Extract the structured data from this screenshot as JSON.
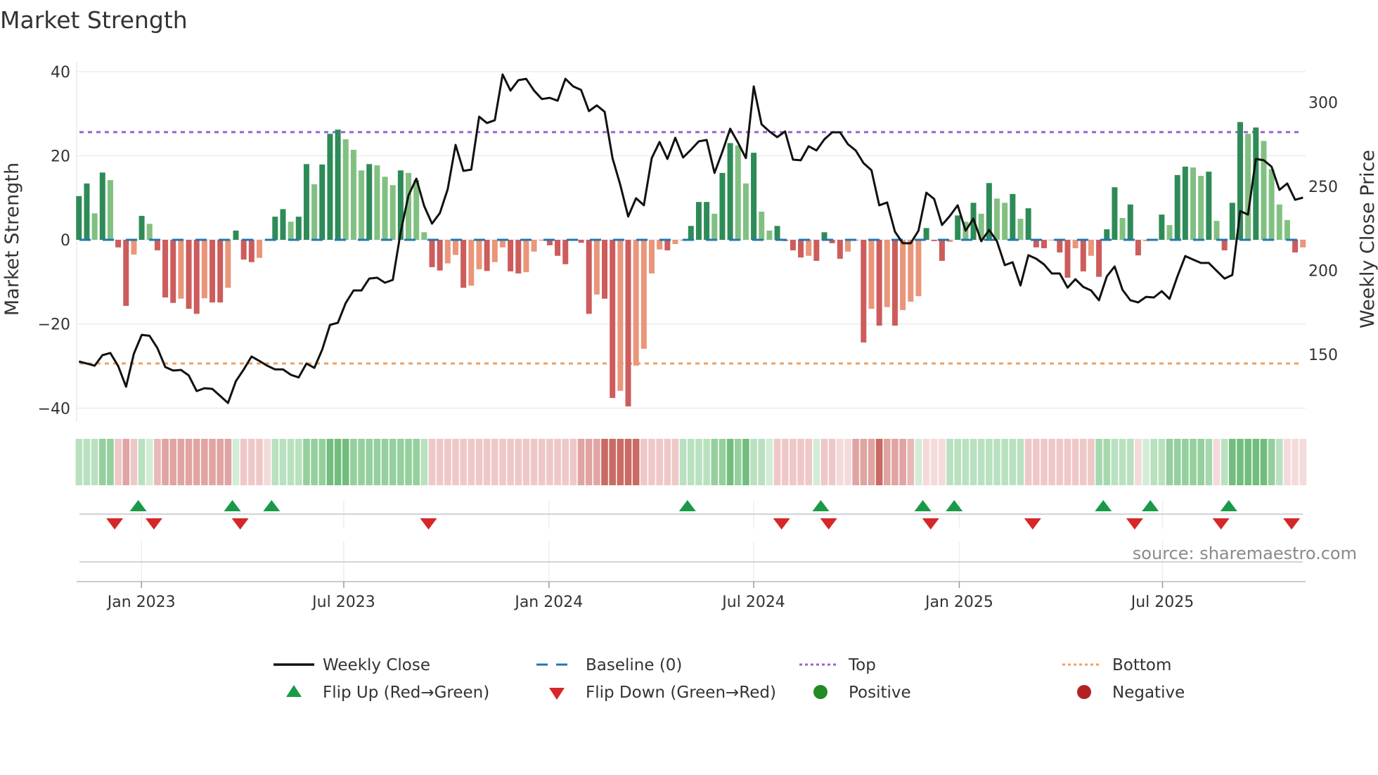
{
  "title": "Market Strength",
  "source": "source: sharemaestro.com",
  "colors": {
    "green_strong": "#2e8b57",
    "green_soft": "#82c082",
    "red_strong": "#cd5c5c",
    "red_soft": "#e9967a",
    "baseline": "#1f77b4",
    "top": "#9b5fd6",
    "bottom": "#f0a060",
    "price": "#111111",
    "flip_up": "#1a9a48",
    "flip_down": "#d62728",
    "positive": "#228b22",
    "negative": "#b22222"
  },
  "legend": [
    {
      "label": "Weekly Close",
      "kind": "line"
    },
    {
      "label": "Baseline (0)",
      "kind": "dash"
    },
    {
      "label": "Top",
      "kind": "dot-purple"
    },
    {
      "label": "Bottom",
      "kind": "dot-orange"
    },
    {
      "label": "Flip Up (Red→Green)",
      "kind": "triangle-up"
    },
    {
      "label": "Flip Down (Green→Red)",
      "kind": "triangle-down"
    },
    {
      "label": "Positive",
      "kind": "circle-green"
    },
    {
      "label": "Negative",
      "kind": "circle-red"
    }
  ],
  "chart_data": {
    "type": "bar",
    "title": "Market Strength",
    "ylabel": "Market Strength",
    "y2label": "Weekly Close Price",
    "ylim": [
      -43.3,
      42.3
    ],
    "y2lim": [
      109.7,
      324.1
    ],
    "yticks": [
      40,
      20,
      0,
      -20,
      -40
    ],
    "yticklabels": [
      "40",
      "20",
      "0",
      "−20",
      "−40"
    ],
    "y2ticks": [
      300,
      250,
      200,
      150
    ],
    "y2ticklabels": [
      "300",
      "250",
      "200",
      "150"
    ],
    "xticks": [
      {
        "label": "Jan 2023",
        "week": 7.97
      },
      {
        "label": "Jul 2023",
        "week": 33.75
      },
      {
        "label": "Jan 2024",
        "week": 59.9
      },
      {
        "label": "Jul 2024",
        "week": 86.0
      },
      {
        "label": "Jan 2025",
        "week": 112.2
      },
      {
        "label": "Jul 2025",
        "week": 138.1
      }
    ],
    "grid": true,
    "legend_position": "bottom",
    "top_level": 25.6,
    "bottom_level": -29.4,
    "baseline": 0,
    "strength": [
      10.4,
      13.4,
      6.3,
      16,
      14.2,
      -1.8,
      -15.7,
      -3.5,
      5.7,
      3.8,
      -2.5,
      -13.7,
      -15,
      -14,
      -16.4,
      -17.6,
      -13.9,
      -14.9,
      -14.9,
      -11.4,
      2.2,
      -4.7,
      -5.3,
      -4.3,
      -0.2,
      5.5,
      7.3,
      4.3,
      5.5,
      18,
      13.2,
      17.9,
      25.2,
      26.2,
      23.9,
      21.4,
      16.5,
      18,
      17.7,
      15,
      13,
      16.5,
      15.9,
      14.2,
      1.8,
      -6.5,
      -7.3,
      -5.6,
      -3.6,
      -11.4,
      -10.9,
      -7,
      -7.4,
      -5.3,
      -1.8,
      -7.5,
      -8,
      -7.7,
      -2.8,
      -0.2,
      -1.3,
      -3.8,
      -5.8,
      -0.1,
      -0.7,
      -17.6,
      -13,
      -14,
      -37.6,
      -35.9,
      -39.6,
      -29.9,
      -25.9,
      -8,
      -2.3,
      -2.5,
      -1,
      -0.2,
      3.3,
      9,
      9,
      6.2,
      15.9,
      23,
      22.4,
      13.4,
      20.7,
      6.7,
      2.2,
      3.3,
      -0.3,
      -2.5,
      -4.2,
      -3.8,
      -5,
      1.8,
      -0.8,
      -4.5,
      -2.8,
      -0.2,
      -24.4,
      -16.4,
      -20.4,
      -16,
      -20.4,
      -16.7,
      -14.7,
      -13.4,
      2.8,
      -0.3,
      -5,
      -0.5,
      5.8,
      4.3,
      8.8,
      6.2,
      13.5,
      9.8,
      8.8,
      10.9,
      5,
      7.5,
      -1.8,
      -2,
      -0.1,
      -3,
      -9,
      -2,
      -7.5,
      -3.8,
      -8.8,
      2.5,
      12.5,
      5.2,
      8.4,
      -3.7,
      -0.3,
      0.1,
      6,
      3.5,
      15.4,
      17.4,
      17.2,
      15.2,
      16.2,
      4.5,
      -2.5,
      8.8,
      28,
      25.2,
      26.7,
      23.5,
      16.8,
      8.4,
      4.7,
      -3,
      -1.8
    ],
    "weekly_close": [
      145.7,
      144.5,
      143.2,
      149.5,
      150.8,
      143,
      130.7,
      150.3,
      161.6,
      161,
      153.7,
      142.4,
      140.3,
      140.7,
      137.4,
      128.1,
      129.8,
      129.4,
      125.2,
      121,
      134,
      141,
      148.7,
      146,
      143.2,
      141,
      141,
      137.8,
      136.2,
      144.5,
      141.9,
      152.8,
      167.5,
      168.8,
      180.5,
      188,
      188,
      195.1,
      195.6,
      192.6,
      194.3,
      222.8,
      244.6,
      254.6,
      238.3,
      227.8,
      234.1,
      248.3,
      274.7,
      259.2,
      260,
      291.5,
      287.7,
      289.4,
      316.6,
      307,
      313.2,
      314,
      307,
      302,
      302.7,
      301,
      314,
      309.5,
      307.4,
      294.8,
      298.2,
      294.4,
      266.8,
      250.8,
      232,
      242.9,
      238.7,
      266.8,
      276.4,
      266.3,
      278.9,
      267.2,
      271.8,
      276.8,
      277.6,
      258,
      270.5,
      284.3,
      276,
      266.8,
      309.5,
      286.9,
      282.7,
      279.3,
      282.7,
      265.9,
      265.5,
      273.9,
      271.4,
      278,
      282.2,
      282.2,
      275.1,
      271.4,
      263.8,
      259.6,
      238.7,
      240.4,
      223,
      216.1,
      216.1,
      223.6,
      246.2,
      242.5,
      227,
      232.4,
      238.7,
      223.6,
      230.7,
      217.3,
      224,
      217.3,
      203.1,
      204.8,
      191,
      209,
      206.9,
      203.5,
      198.1,
      198.1,
      189.7,
      194.7,
      190.1,
      188,
      182.2,
      196.4,
      202.3,
      188.4,
      182.2,
      180.9,
      184.2,
      183.8,
      187.6,
      183,
      196.4,
      208.5,
      206.4,
      204.4,
      204.4,
      199.7,
      195.1,
      197.2,
      235.3,
      233.2,
      266.3,
      265.5,
      261.7,
      247.9,
      251.7,
      242,
      243.3
    ],
    "regime_strip": [
      1,
      1,
      1,
      2,
      2,
      -1,
      -2,
      -1,
      1,
      0.5,
      -1.5,
      -2,
      -2,
      -2,
      -2,
      -2,
      -2,
      -2,
      -2,
      -2,
      0.5,
      -1,
      -1,
      -1,
      -0.5,
      1,
      1,
      1,
      1,
      2,
      2,
      2,
      3,
      3,
      3,
      2,
      2,
      2,
      2,
      2,
      2,
      2,
      2,
      2,
      1,
      -1,
      -1,
      -1,
      -1,
      -1,
      -1,
      -1,
      -1,
      -1,
      -1,
      -1,
      -1,
      -1,
      -1,
      -1,
      -1,
      -1,
      -1,
      -1,
      -2,
      -2,
      -2,
      -3,
      -3,
      -3,
      -3,
      -3,
      -1,
      -1,
      -1,
      -1,
      -1,
      1,
      1,
      1,
      1,
      2,
      2,
      3,
      2,
      3,
      1,
      1,
      0.5,
      -1,
      -1,
      -1,
      -1,
      -1,
      0.5,
      -1,
      -1,
      -0.5,
      -0.5,
      -2,
      -2,
      -2,
      -3,
      -2,
      -2,
      -2,
      -1.5,
      0.5,
      -0.5,
      -0.5,
      -0.5,
      1,
      1,
      1,
      1,
      1,
      1,
      1,
      1,
      1,
      1,
      -1,
      -1,
      -1,
      -1,
      -1,
      -1,
      -1,
      -1,
      -1,
      1.5,
      1.5,
      1,
      1,
      1,
      -0.5,
      0.5,
      1,
      1,
      2,
      2,
      2,
      2,
      2,
      1.5,
      -0.5,
      1,
      3,
      3,
      3,
      3,
      3,
      2,
      1,
      -0.5,
      -0.5,
      -0.5
    ],
    "flip_up_weeks": [
      8,
      20,
      25,
      78,
      95,
      108,
      112,
      131,
      137,
      147
    ],
    "flip_down_weeks": [
      5,
      10,
      21,
      45,
      90,
      96,
      109,
      122,
      135,
      146,
      155
    ]
  }
}
